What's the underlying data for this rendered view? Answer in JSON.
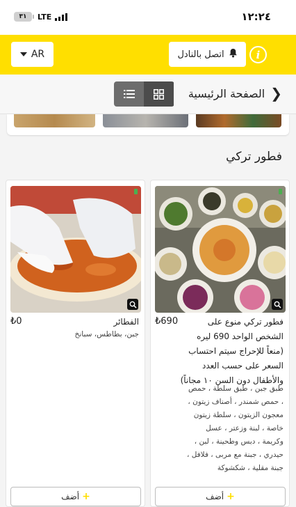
{
  "status_bar": {
    "time": "١٢:٢٤",
    "battery": "٣١",
    "network": "LTE"
  },
  "header": {
    "language": "AR",
    "call_waiter": "اتصل بالنادل"
  },
  "nav": {
    "title": "الصفحة الرئيسية"
  },
  "section": {
    "title": "فطور تركي"
  },
  "items": [
    {
      "name": "فطور تركي منوع على الشخص الواحد 690 ليره (منعاً للإحراج سيتم احتساب السعر على حسب العدد والأطفال دون السن ١٠ مجاناً)",
      "price": "₺690",
      "description": "طبق جبن ، طبق سلطة ، حمص ، حمص شمندر ، أصناف زيتون ، معجون الزيتون ، سلطة زيتون خاصة ، لبنة وزعتر ، عسل وكريمة ، دبس وطحينة ، لبن ، حيدري ، جبنة مع مربى ، فلافل ، جبنة مقلية ، شكشوكة",
      "add_label": "أضف"
    },
    {
      "name": "الفطائر",
      "price": "₺0",
      "description": "جبن، بطاطس، سبانخ",
      "add_label": "أضف"
    }
  ],
  "colors": {
    "accent": "#ffdf00",
    "toggle_dark": "#4c4c4c",
    "toggle_light": "#6d6d6d"
  },
  "icons": [
    "info-icon",
    "bell-icon",
    "chevron-down-icon",
    "back-chevron-icon",
    "grid-view-icon",
    "list-view-icon",
    "zoom-icon",
    "plus-icon"
  ]
}
